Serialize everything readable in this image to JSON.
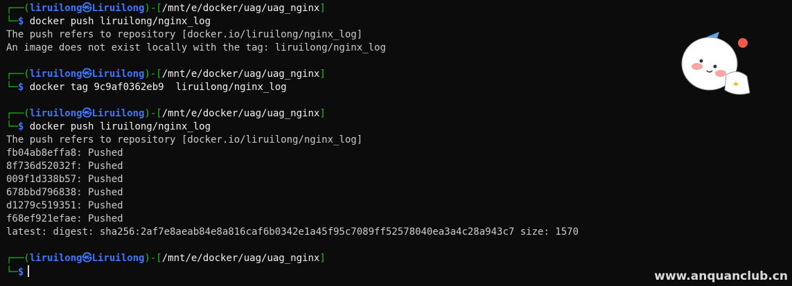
{
  "prompt": {
    "user": "liruilong",
    "separator": "㉿",
    "host": "Liruilong",
    "path": "/mnt/e/docker/uag/uag_nginx",
    "symbol": "$"
  },
  "blocks": [
    {
      "command": "docker push liruilong/nginx_log",
      "output": [
        "The push refers to repository [docker.io/liruilong/nginx_log]",
        "An image does not exist locally with the tag: liruilong/nginx_log"
      ]
    },
    {
      "command": "docker tag 9c9af0362eb9  liruilong/nginx_log",
      "output": []
    },
    {
      "command": "docker push liruilong/nginx_log",
      "output": [
        "The push refers to repository [docker.io/liruilong/nginx_log]",
        "fb04ab8effa8: Pushed",
        "8f736d52032f: Pushed",
        "009f1d338b57: Pushed",
        "678bbd796838: Pushed",
        "d1279c519351: Pushed",
        "f68ef921efae: Pushed",
        "latest: digest: sha256:2af7e8aeab84e8a816caf6b0342e1a45f95c7089ff52578040ea3a4c28a943c7 size: 1570"
      ]
    },
    {
      "command": "",
      "output": []
    }
  ],
  "watermark": "www.anquanclub.cn",
  "colors": {
    "background": "#0c0c0c",
    "prompt_frame": "#16c60c",
    "user_host": "#3b78ff",
    "text": "#cccccc"
  },
  "icons": {
    "sticker": "cartoon-character-sticker"
  }
}
